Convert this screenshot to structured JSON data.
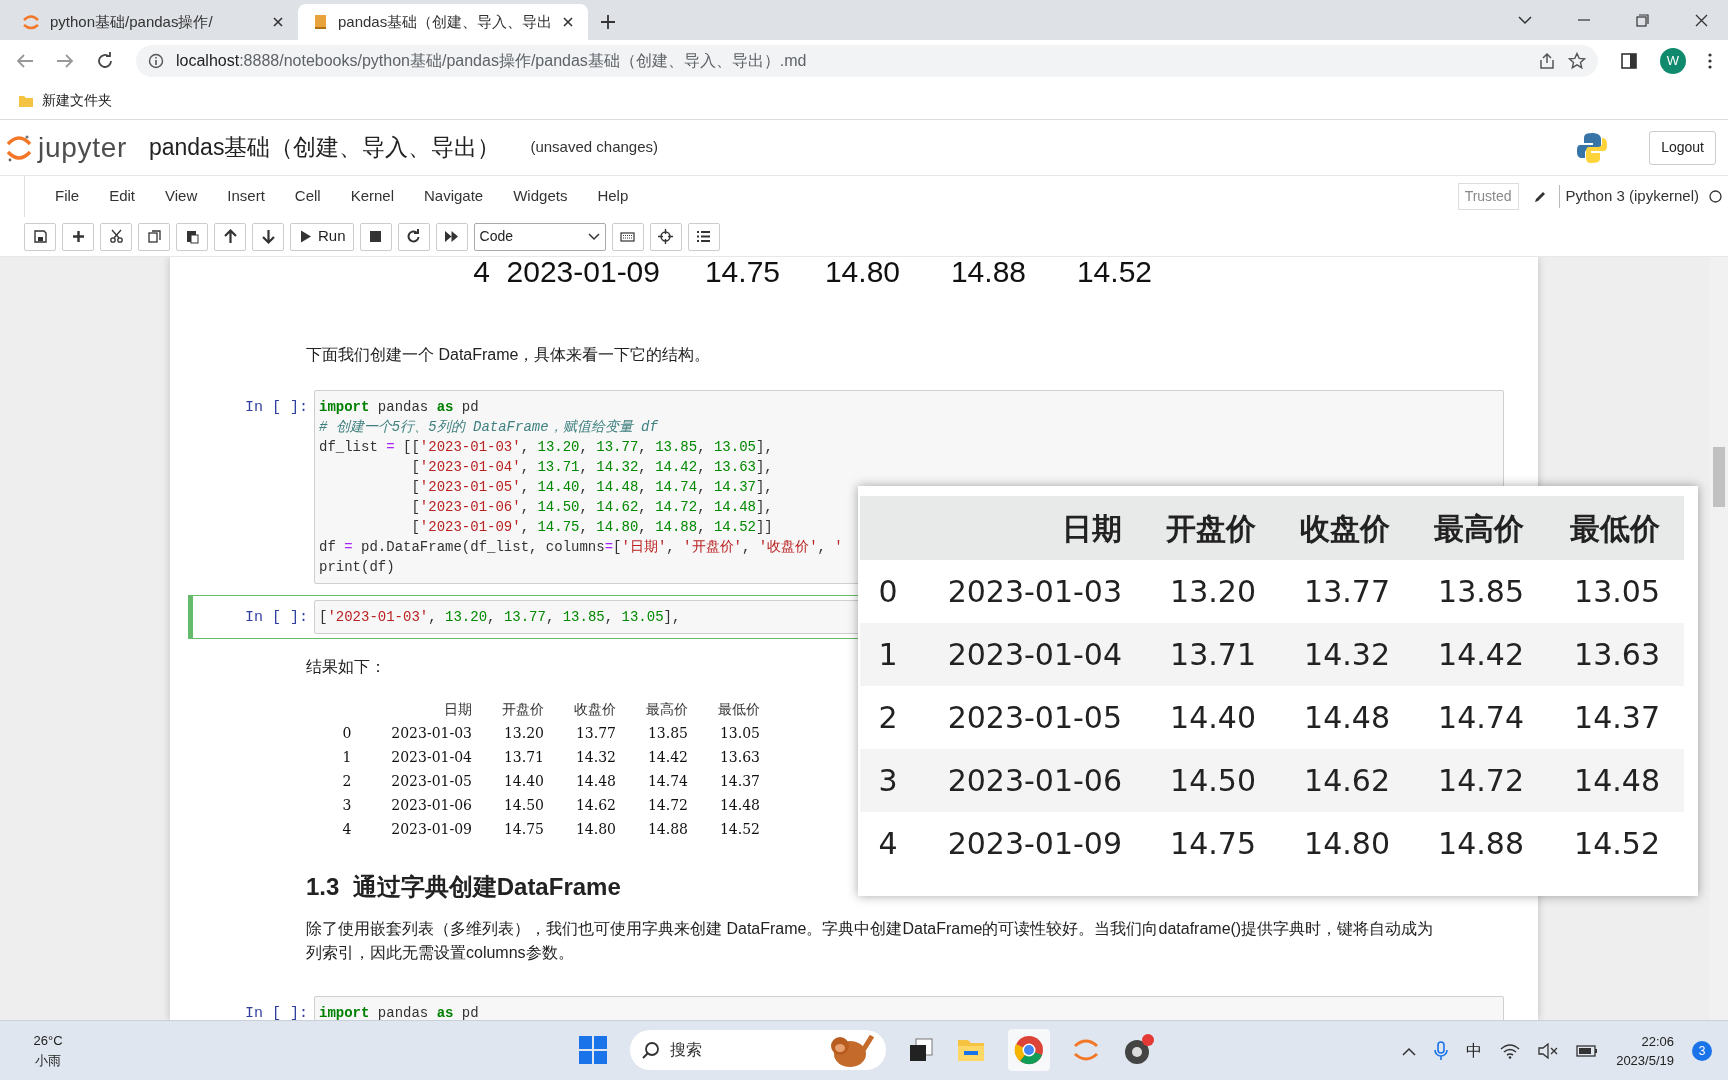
{
  "browser": {
    "tabs": [
      {
        "label": "python基础/pandas操作/",
        "selected": false
      },
      {
        "label": "pandas基础（创建、导入、导出",
        "selected": true
      }
    ],
    "url_host": "localhost",
    "url_rest": ":8888/notebooks/python基础/pandas操作/pandas基础（创建、导入、导出）.md",
    "profile_letter": "W",
    "bookmarks": [
      "新建文件夹"
    ]
  },
  "jupyter": {
    "logo_text": "jupyter",
    "title": "pandas基础（创建、导入、导出）",
    "save_status": "(unsaved changes)",
    "logout": "Logout",
    "menu": [
      "File",
      "Edit",
      "View",
      "Insert",
      "Cell",
      "Kernel",
      "Navigate",
      "Widgets",
      "Help"
    ],
    "trusted": "Trusted",
    "kernel": "Python 3 (ipykernel)",
    "run_label": "Run",
    "cell_type": "Code"
  },
  "cells": [
    {
      "kind": "partial_row",
      "values": [
        "4",
        "2023-01-09",
        "14.75",
        "14.80",
        "14.88",
        "14.52"
      ]
    },
    {
      "kind": "markdown",
      "text": "下面我们创建一个 DataFrame，具体来看一下它的结构。"
    },
    {
      "kind": "code",
      "prompt": "In [ ]:",
      "selected": false,
      "lines": [
        [
          {
            "kind": "keyword",
            "text": "import"
          },
          {
            "kind": "plain",
            "text": " pandas "
          },
          {
            "kind": "keyword",
            "text": "as"
          },
          {
            "kind": "plain",
            "text": " pd"
          }
        ],
        [
          {
            "kind": "comment",
            "text": "# 创建一个5行、5列的 DataFrame，赋值给变量 df"
          }
        ],
        [
          {
            "kind": "plain",
            "text": "df_list "
          },
          {
            "kind": "operator",
            "text": "="
          },
          {
            "kind": "plain",
            "text": " [["
          },
          {
            "kind": "string",
            "text": "'2023-01-03'"
          },
          {
            "kind": "plain",
            "text": ", "
          },
          {
            "kind": "number",
            "text": "13.20"
          },
          {
            "kind": "plain",
            "text": ", "
          },
          {
            "kind": "number",
            "text": "13.77"
          },
          {
            "kind": "plain",
            "text": ", "
          },
          {
            "kind": "number",
            "text": "13.85"
          },
          {
            "kind": "plain",
            "text": ", "
          },
          {
            "kind": "number",
            "text": "13.05"
          },
          {
            "kind": "plain",
            "text": "],"
          }
        ],
        [
          {
            "kind": "plain",
            "text": "           ["
          },
          {
            "kind": "string",
            "text": "'2023-01-04'"
          },
          {
            "kind": "plain",
            "text": ", "
          },
          {
            "kind": "number",
            "text": "13.71"
          },
          {
            "kind": "plain",
            "text": ", "
          },
          {
            "kind": "number",
            "text": "14.32"
          },
          {
            "kind": "plain",
            "text": ", "
          },
          {
            "kind": "number",
            "text": "14.42"
          },
          {
            "kind": "plain",
            "text": ", "
          },
          {
            "kind": "number",
            "text": "13.63"
          },
          {
            "kind": "plain",
            "text": "],"
          }
        ],
        [
          {
            "kind": "plain",
            "text": "           ["
          },
          {
            "kind": "string",
            "text": "'2023-01-05'"
          },
          {
            "kind": "plain",
            "text": ", "
          },
          {
            "kind": "number",
            "text": "14.40"
          },
          {
            "kind": "plain",
            "text": ", "
          },
          {
            "kind": "number",
            "text": "14.48"
          },
          {
            "kind": "plain",
            "text": ", "
          },
          {
            "kind": "number",
            "text": "14.74"
          },
          {
            "kind": "plain",
            "text": ", "
          },
          {
            "kind": "number",
            "text": "14.37"
          },
          {
            "kind": "plain",
            "text": "],"
          }
        ],
        [
          {
            "kind": "plain",
            "text": "           ["
          },
          {
            "kind": "string",
            "text": "'2023-01-06'"
          },
          {
            "kind": "plain",
            "text": ", "
          },
          {
            "kind": "number",
            "text": "14.50"
          },
          {
            "kind": "plain",
            "text": ", "
          },
          {
            "kind": "number",
            "text": "14.62"
          },
          {
            "kind": "plain",
            "text": ", "
          },
          {
            "kind": "number",
            "text": "14.72"
          },
          {
            "kind": "plain",
            "text": ", "
          },
          {
            "kind": "number",
            "text": "14.48"
          },
          {
            "kind": "plain",
            "text": "],"
          }
        ],
        [
          {
            "kind": "plain",
            "text": "           ["
          },
          {
            "kind": "string",
            "text": "'2023-01-09'"
          },
          {
            "kind": "plain",
            "text": ", "
          },
          {
            "kind": "number",
            "text": "14.75"
          },
          {
            "kind": "plain",
            "text": ", "
          },
          {
            "kind": "number",
            "text": "14.80"
          },
          {
            "kind": "plain",
            "text": ", "
          },
          {
            "kind": "number",
            "text": "14.88"
          },
          {
            "kind": "plain",
            "text": ", "
          },
          {
            "kind": "number",
            "text": "14.52"
          },
          {
            "kind": "plain",
            "text": "]]"
          }
        ],
        [
          {
            "kind": "plain",
            "text": "df "
          },
          {
            "kind": "operator",
            "text": "="
          },
          {
            "kind": "plain",
            "text": " pd.DataFrame(df_list, columns"
          },
          {
            "kind": "operator",
            "text": "="
          },
          {
            "kind": "plain",
            "text": "["
          },
          {
            "kind": "string",
            "text": "'日期'"
          },
          {
            "kind": "plain",
            "text": ", "
          },
          {
            "kind": "string",
            "text": "'开盘价'"
          },
          {
            "kind": "plain",
            "text": ", "
          },
          {
            "kind": "string",
            "text": "'收盘价'"
          },
          {
            "kind": "plain",
            "text": ", "
          },
          {
            "kind": "string",
            "text": "'"
          }
        ],
        [
          {
            "kind": "plain",
            "text": "print(df)"
          }
        ]
      ]
    },
    {
      "kind": "code",
      "prompt": "In [ ]:",
      "selected": true,
      "lines": [
        [
          {
            "kind": "plain",
            "text": "["
          },
          {
            "kind": "string",
            "text": "'2023-01-03'"
          },
          {
            "kind": "plain",
            "text": ", "
          },
          {
            "kind": "number",
            "text": "13.20"
          },
          {
            "kind": "plain",
            "text": ", "
          },
          {
            "kind": "number",
            "text": "13.77"
          },
          {
            "kind": "plain",
            "text": ", "
          },
          {
            "kind": "number",
            "text": "13.85"
          },
          {
            "kind": "plain",
            "text": ", "
          },
          {
            "kind": "number",
            "text": "13.05"
          },
          {
            "kind": "plain",
            "text": "],"
          }
        ]
      ]
    },
    {
      "kind": "markdown",
      "text": "结果如下："
    },
    {
      "kind": "text_table",
      "columns": [
        "",
        "日期",
        "开盘价",
        "收盘价",
        "最高价",
        "最低价"
      ],
      "rows": [
        [
          "0",
          "2023-01-03",
          "13.20",
          "13.77",
          "13.85",
          "13.05"
        ],
        [
          "1",
          "2023-01-04",
          "13.71",
          "14.32",
          "14.42",
          "13.63"
        ],
        [
          "2",
          "2023-01-05",
          "14.40",
          "14.48",
          "14.74",
          "14.37"
        ],
        [
          "3",
          "2023-01-06",
          "14.50",
          "14.62",
          "14.72",
          "14.48"
        ],
        [
          "4",
          "2023-01-09",
          "14.75",
          "14.80",
          "14.88",
          "14.52"
        ]
      ]
    },
    {
      "kind": "heading",
      "number": "1.3",
      "text": "通过字典创建DataFrame"
    },
    {
      "kind": "paragraph",
      "lines": [
        "除了使用嵌套列表（多维列表），我们也可使用字典来创建 DataFrame。字典中创建DataFrame的可读性较好。当我们向dataframe()提供字典时，键将自动成为",
        "列索引，因此无需设置columns参数。"
      ]
    },
    {
      "kind": "code",
      "prompt": "In [ ]:",
      "selected": false,
      "lines": [
        [
          {
            "kind": "keyword",
            "text": "import"
          },
          {
            "kind": "plain",
            "text": " pandas "
          },
          {
            "kind": "keyword",
            "text": "as"
          },
          {
            "kind": "plain",
            "text": " pd"
          }
        ]
      ]
    }
  ],
  "popup_table": {
    "columns": [
      "",
      "日期",
      "开盘价",
      "收盘价",
      "最高价",
      "最低价"
    ],
    "rows": [
      [
        "0",
        "2023-01-03",
        "13.20",
        "13.77",
        "13.85",
        "13.05"
      ],
      [
        "1",
        "2023-01-04",
        "13.71",
        "14.32",
        "14.42",
        "13.63"
      ],
      [
        "2",
        "2023-01-05",
        "14.40",
        "14.48",
        "14.74",
        "14.37"
      ],
      [
        "3",
        "2023-01-06",
        "14.50",
        "14.62",
        "14.72",
        "14.48"
      ],
      [
        "4",
        "2023-01-09",
        "14.75",
        "14.80",
        "14.88",
        "14.52"
      ]
    ]
  },
  "taskbar": {
    "temperature": "26°C",
    "weather": "小雨",
    "search": "搜索",
    "ime": "中",
    "time": "22:06",
    "date": "2023/5/19",
    "notifications": "3"
  }
}
